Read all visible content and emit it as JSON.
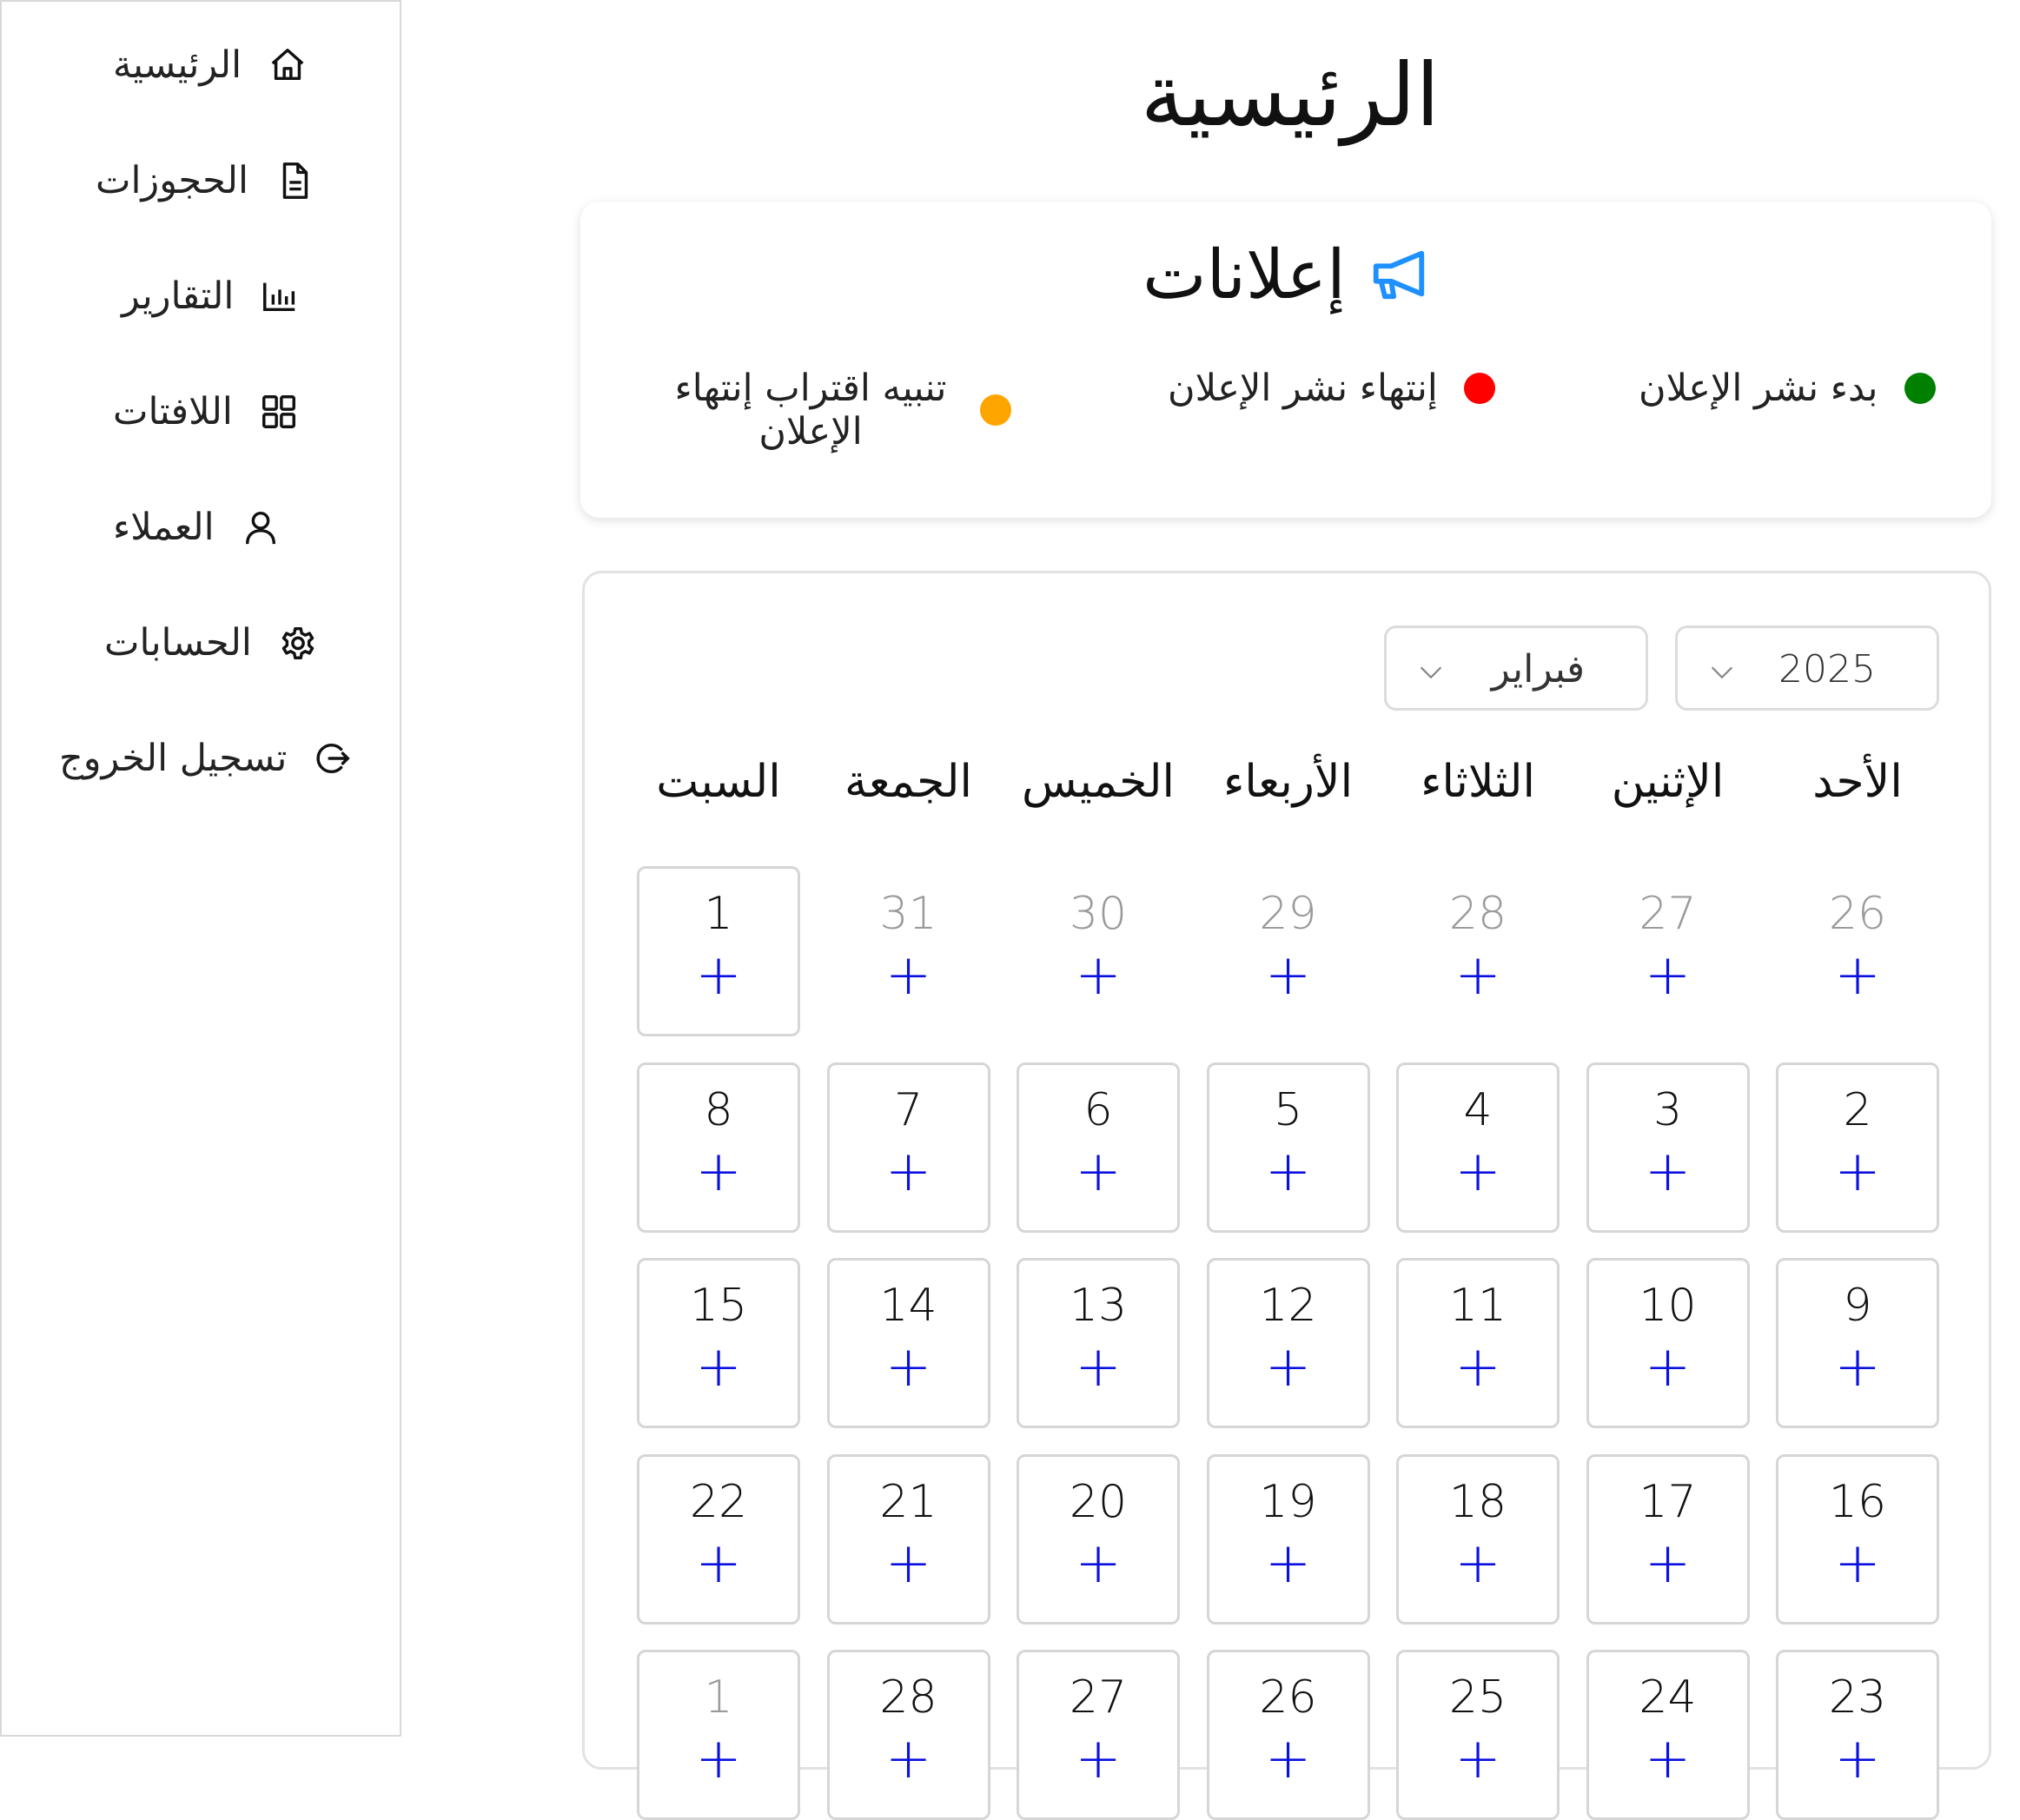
{
  "sidebar": {
    "items": [
      {
        "label": "الرئيسية",
        "icon": "home-icon"
      },
      {
        "label": "الحجوزات",
        "icon": "document-icon"
      },
      {
        "label": "التقارير",
        "icon": "bar-chart-icon"
      },
      {
        "label": "اللافتات",
        "icon": "grid-icon"
      },
      {
        "label": "العملاء",
        "icon": "user-icon"
      },
      {
        "label": "الحسابات",
        "icon": "gear-icon"
      },
      {
        "label": "تسجيل الخروج",
        "icon": "logout-icon"
      }
    ]
  },
  "main": {
    "title": "الرئيسية"
  },
  "announcements": {
    "title": "إعلانات",
    "icon": "megaphone-icon",
    "legend": [
      {
        "label": "بدء نشر الإعلان",
        "color": "#008000"
      },
      {
        "label": "إنتهاء نشر الإعلان",
        "color": "#ff0000"
      },
      {
        "label": "تنبيه اقتراب إنتهاء الإعلان",
        "color": "#ffa500"
      }
    ]
  },
  "calendar": {
    "month": "فبراير",
    "year": "2025",
    "weekdays": [
      "الأحد",
      "الإثنين",
      "الثلاثاء",
      "الأربعاء",
      "الخميس",
      "الجمعة",
      "السبت"
    ],
    "add_symbol": "+",
    "add_color": "#0a10e0",
    "weeks": [
      [
        {
          "day": "26",
          "muted": true
        },
        {
          "day": "27",
          "muted": true
        },
        {
          "day": "28",
          "muted": true
        },
        {
          "day": "29",
          "muted": true
        },
        {
          "day": "30",
          "muted": true
        },
        {
          "day": "31",
          "muted": true
        },
        {
          "day": "1",
          "muted": false
        }
      ],
      [
        {
          "day": "2",
          "muted": false
        },
        {
          "day": "3",
          "muted": false
        },
        {
          "day": "4",
          "muted": false
        },
        {
          "day": "5",
          "muted": false
        },
        {
          "day": "6",
          "muted": false
        },
        {
          "day": "7",
          "muted": false
        },
        {
          "day": "8",
          "muted": false
        }
      ],
      [
        {
          "day": "9",
          "muted": false
        },
        {
          "day": "10",
          "muted": false
        },
        {
          "day": "11",
          "muted": false
        },
        {
          "day": "12",
          "muted": false
        },
        {
          "day": "13",
          "muted": false
        },
        {
          "day": "14",
          "muted": false
        },
        {
          "day": "15",
          "muted": false
        }
      ],
      [
        {
          "day": "16",
          "muted": false
        },
        {
          "day": "17",
          "muted": false
        },
        {
          "day": "18",
          "muted": false
        },
        {
          "day": "19",
          "muted": false
        },
        {
          "day": "20",
          "muted": false
        },
        {
          "day": "21",
          "muted": false
        },
        {
          "day": "22",
          "muted": false
        }
      ],
      [
        {
          "day": "23",
          "muted": false
        },
        {
          "day": "24",
          "muted": false
        },
        {
          "day": "25",
          "muted": false
        },
        {
          "day": "26",
          "muted": false
        },
        {
          "day": "27",
          "muted": false
        },
        {
          "day": "28",
          "muted": false
        },
        {
          "day": "1",
          "muted": true
        }
      ]
    ]
  }
}
